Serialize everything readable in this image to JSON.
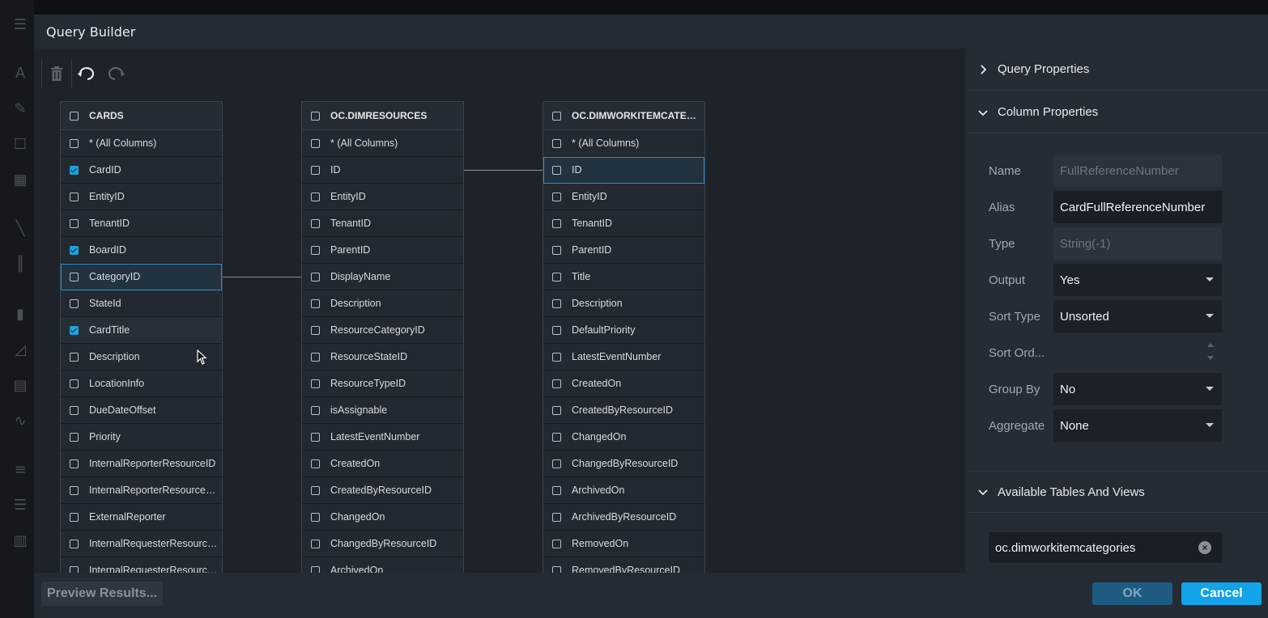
{
  "dialog": {
    "title": "Query Builder"
  },
  "toolbar": {
    "delete_icon": "trash-icon",
    "undo_icon": "undo-icon",
    "redo_icon": "redo-icon"
  },
  "tables": [
    {
      "name": "CARDS",
      "columns": [
        {
          "label": "* (All Columns)",
          "checked": false
        },
        {
          "label": "CardID",
          "checked": true
        },
        {
          "label": "EntityID",
          "checked": false
        },
        {
          "label": "TenantID",
          "checked": false
        },
        {
          "label": "BoardID",
          "checked": true
        },
        {
          "label": "CategoryID",
          "checked": false
        },
        {
          "label": "StateId",
          "checked": false
        },
        {
          "label": "CardTitle",
          "checked": true
        },
        {
          "label": "Description",
          "checked": false
        },
        {
          "label": "LocationInfo",
          "checked": false
        },
        {
          "label": "DueDateOffset",
          "checked": false
        },
        {
          "label": "Priority",
          "checked": false
        },
        {
          "label": "InternalReporterResourceID",
          "checked": false
        },
        {
          "label": "InternalReporterResourceC...",
          "checked": false
        },
        {
          "label": "ExternalReporter",
          "checked": false
        },
        {
          "label": "InternalRequesterResource...",
          "checked": false
        },
        {
          "label": "InternalRequesterResource...",
          "checked": false
        }
      ]
    },
    {
      "name": "OC.DIMRESOURCES",
      "columns": [
        {
          "label": "* (All Columns)",
          "checked": false
        },
        {
          "label": "ID",
          "checked": false
        },
        {
          "label": "EntityID",
          "checked": false
        },
        {
          "label": "TenantID",
          "checked": false
        },
        {
          "label": "ParentID",
          "checked": false
        },
        {
          "label": "DisplayName",
          "checked": false
        },
        {
          "label": "Description",
          "checked": false
        },
        {
          "label": "ResourceCategoryID",
          "checked": false
        },
        {
          "label": "ResourceStateID",
          "checked": false
        },
        {
          "label": "ResourceTypeID",
          "checked": false
        },
        {
          "label": "isAssignable",
          "checked": false
        },
        {
          "label": "LatestEventNumber",
          "checked": false
        },
        {
          "label": "CreatedOn",
          "checked": false
        },
        {
          "label": "CreatedByResourceID",
          "checked": false
        },
        {
          "label": "ChangedOn",
          "checked": false
        },
        {
          "label": "ChangedByResourceID",
          "checked": false
        },
        {
          "label": "ArchivedOn",
          "checked": false
        }
      ]
    },
    {
      "name": "OC.DIMWORKITEMCATEGO...",
      "columns": [
        {
          "label": "* (All Columns)",
          "checked": false
        },
        {
          "label": "ID",
          "checked": false
        },
        {
          "label": "EntityID",
          "checked": false
        },
        {
          "label": "TenantID",
          "checked": false
        },
        {
          "label": "ParentID",
          "checked": false
        },
        {
          "label": "Title",
          "checked": false
        },
        {
          "label": "Description",
          "checked": false
        },
        {
          "label": "DefaultPriority",
          "checked": false
        },
        {
          "label": "LatestEventNumber",
          "checked": false
        },
        {
          "label": "CreatedOn",
          "checked": false
        },
        {
          "label": "CreatedByResourceID",
          "checked": false
        },
        {
          "label": "ChangedOn",
          "checked": false
        },
        {
          "label": "ChangedByResourceID",
          "checked": false
        },
        {
          "label": "ArchivedOn",
          "checked": false
        },
        {
          "label": "ArchivedByResourceID",
          "checked": false
        },
        {
          "label": "RemovedOn",
          "checked": false
        },
        {
          "label": "RemovedByResourceID",
          "checked": false
        }
      ]
    }
  ],
  "panel": {
    "query_properties": "Query Properties",
    "column_properties": "Column Properties",
    "available_tables": "Available Tables And Views",
    "props": {
      "name_label": "Name",
      "name_value": "FullReferenceNumber",
      "alias_label": "Alias",
      "alias_value": "CardFullReferenceNumber",
      "type_label": "Type",
      "type_value": "String(-1)",
      "output_label": "Output",
      "output_value": "Yes",
      "sort_type_label": "Sort Type",
      "sort_type_value": "Unsorted",
      "sort_order_label": "Sort Ord...",
      "group_by_label": "Group By",
      "group_by_value": "No",
      "aggregate_label": "Aggregate",
      "aggregate_value": "None"
    },
    "search_value": "oc.dimworkitemcategories"
  },
  "footer": {
    "preview": "Preview Results...",
    "ok": "OK",
    "cancel": "Cancel"
  },
  "colors": {
    "accent": "#12a3e8",
    "highlight": "#2d8fd0",
    "checked": "#1aa3e0"
  }
}
